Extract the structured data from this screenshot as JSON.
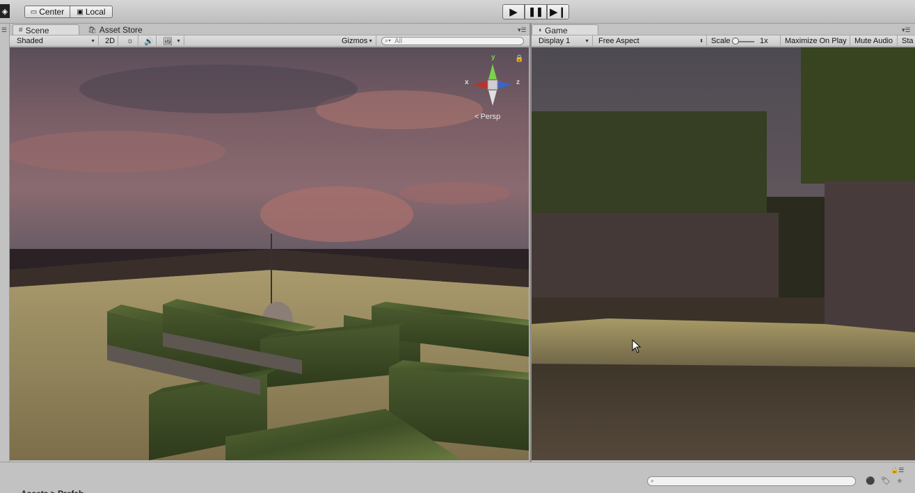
{
  "toolbar": {
    "center_label": "Center",
    "local_label": "Local",
    "play_icon": "play-icon",
    "pause_icon": "pause-icon",
    "step_icon": "step-icon"
  },
  "scene_panel": {
    "tabs": [
      {
        "label": "Scene",
        "icon": "grid-icon"
      },
      {
        "label": "Asset Store",
        "icon": "store-icon"
      }
    ],
    "shading_mode": "Shaded",
    "mode_2d_label": "2D",
    "gizmos_label": "Gizmos",
    "search_placeholder": "All",
    "gizmo": {
      "y_label": "y",
      "x_label": "x",
      "z_label": "z",
      "persp_label": "Persp"
    }
  },
  "game_panel": {
    "tab_label": "Game",
    "display_label": "Display 1",
    "aspect_label": "Free Aspect",
    "scale_label": "Scale",
    "scale_value": "1x",
    "maximize_label": "Maximize On Play",
    "mute_label": "Mute Audio",
    "stats_label": "Sta"
  },
  "bottom_panel": {
    "partial_tab_text": "Assets > Prefab"
  },
  "colors": {
    "editor_bg": "#c2c2c2",
    "gizmo_y": "#7bd24b",
    "gizmo_x": "#c0302a",
    "gizmo_z": "#3e63c8"
  }
}
